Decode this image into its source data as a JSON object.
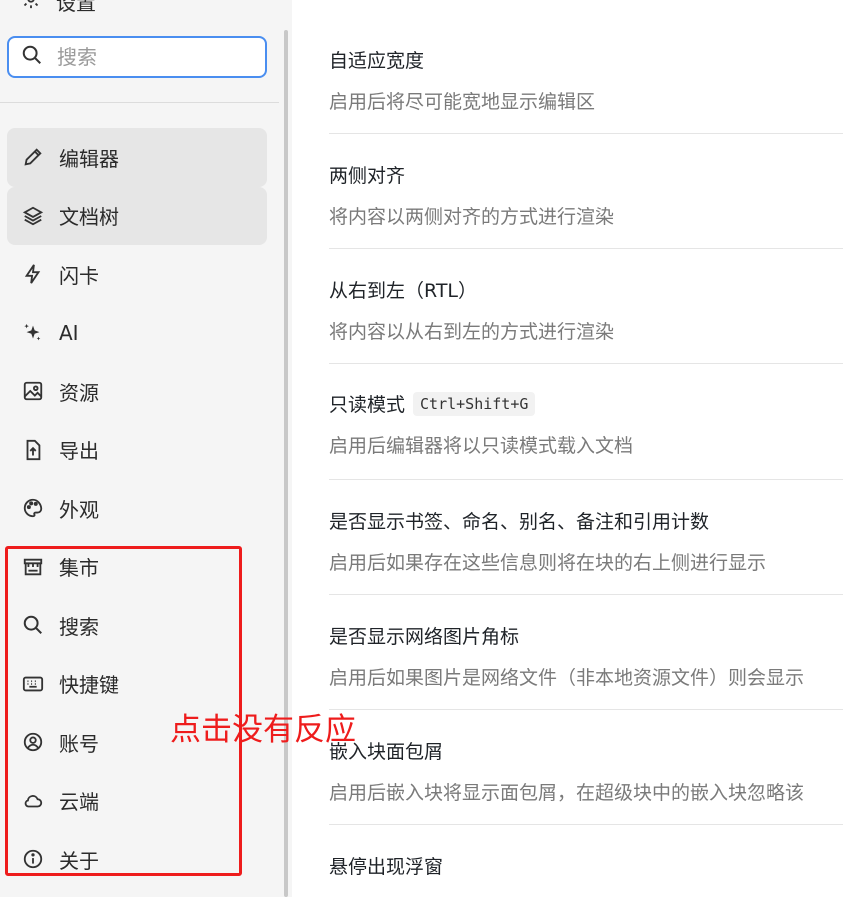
{
  "sidebar": {
    "header_label": "设置",
    "search": {
      "placeholder": "搜索",
      "value": ""
    },
    "items": [
      {
        "label": "编辑器",
        "icon": "pencil-icon",
        "active": true
      },
      {
        "label": "文档树",
        "icon": "layers-icon",
        "active": true
      },
      {
        "label": "闪卡",
        "icon": "lightning-icon",
        "active": false
      },
      {
        "label": "AI",
        "icon": "sparkle-icon",
        "active": false
      },
      {
        "label": "资源",
        "icon": "image-icon",
        "active": false
      },
      {
        "label": "导出",
        "icon": "export-icon",
        "active": false
      },
      {
        "label": "外观",
        "icon": "palette-icon",
        "active": false
      },
      {
        "label": "集市",
        "icon": "store-icon",
        "active": false
      },
      {
        "label": "搜索",
        "icon": "search-icon",
        "active": false
      },
      {
        "label": "快捷键",
        "icon": "keyboard-icon",
        "active": false
      },
      {
        "label": "账号",
        "icon": "account-icon",
        "active": false
      },
      {
        "label": "云端",
        "icon": "cloud-icon",
        "active": false
      },
      {
        "label": "关于",
        "icon": "info-icon",
        "active": false
      }
    ]
  },
  "annotation": {
    "note": "点击没有反应",
    "color": "#ee1c1c"
  },
  "settings": [
    {
      "title": "自适应宽度",
      "desc": "启用后将尽可能宽地显示编辑区"
    },
    {
      "title": "两侧对齐",
      "desc": "将内容以两侧对齐的方式进行渲染"
    },
    {
      "title": "从右到左（RTL）",
      "desc": "将内容以从右到左的方式进行渲染"
    },
    {
      "title": "只读模式",
      "shortcut": "Ctrl+Shift+G",
      "desc": "启用后编辑器将以只读模式载入文档"
    },
    {
      "title": "是否显示书签、命名、别名、备注和引用计数",
      "desc": "启用后如果存在这些信息则将在块的右上侧进行显示"
    },
    {
      "title": "是否显示网络图片角标",
      "desc": "启用后如果图片是网络文件（非本地资源文件）则会显示"
    },
    {
      "title": "嵌入块面包屑",
      "desc": "启用后嵌入块将显示面包屑，在超级块中的嵌入块忽略该"
    },
    {
      "title": "悬停出现浮窗",
      "desc": ""
    }
  ],
  "colors": {
    "accent": "#4a8ef0",
    "sidebar_bg": "#f5f5f5",
    "active_bg": "#e6e6e6"
  }
}
